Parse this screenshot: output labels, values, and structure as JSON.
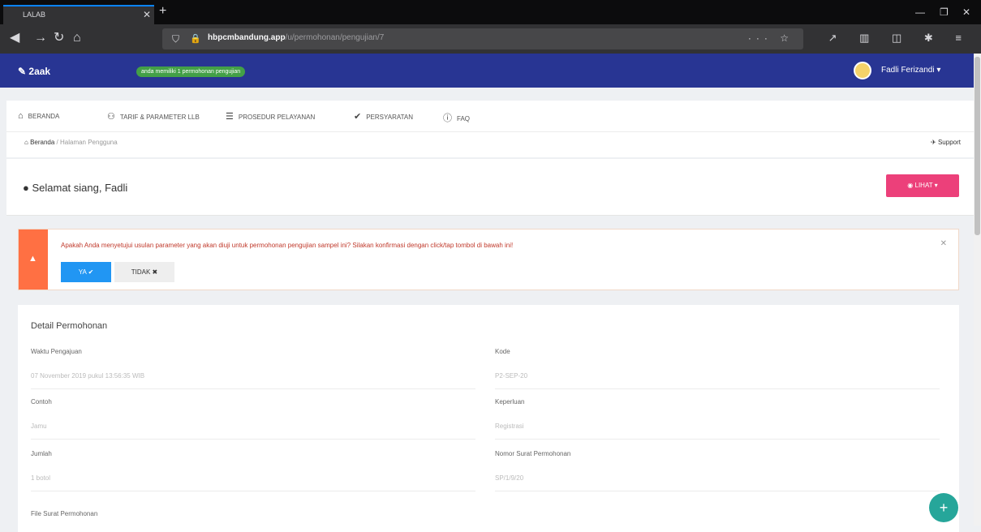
{
  "browser": {
    "tab_title": "LALAB",
    "url_host": "hbpcmbandung.app",
    "url_path": "/u/permohonan/pengujian/7"
  },
  "header": {
    "badge": "anda memiliki 1 permohonan pengujian",
    "username": "Fadli Ferizandi"
  },
  "menu": {
    "items": [
      "BERANDA",
      "TARIF & PARAMETER LLB",
      "PROSEDUR PELAYANAN",
      "PERSYARATAN",
      "FAQ"
    ]
  },
  "breadcrumb": {
    "home": "Beranda",
    "current": "Halaman Pengguna"
  },
  "support_label": "Support",
  "greeting": "Selamat siang, Fadli",
  "lihat_label": "LIHAT",
  "alert": {
    "text": "Apakah Anda menyetujui usulan parameter yang akan diuji untuk permohonan pengujian sampel ini? Silakan konfirmasi dengan click/tap tombol di bawah ini!",
    "yes_label": "YA",
    "no_label": "TIDAK"
  },
  "detail": {
    "title": "Detail Permohonan",
    "fields": [
      {
        "label": "Waktu Pengajuan",
        "value": "07 November 2019 pukul 13:56:35 WIB"
      },
      {
        "label": "Kode",
        "value": "P2-SEP-20"
      },
      {
        "label": "Contoh",
        "value": "Jamu"
      },
      {
        "label": "Keperluan",
        "value": "Registrasi"
      },
      {
        "label": "Jumlah",
        "value": "1 botol"
      },
      {
        "label": "Nomor Surat Permohonan",
        "value": "SP/1/9/20"
      },
      {
        "label": "File Surat Permohonan",
        "value": ""
      }
    ]
  }
}
